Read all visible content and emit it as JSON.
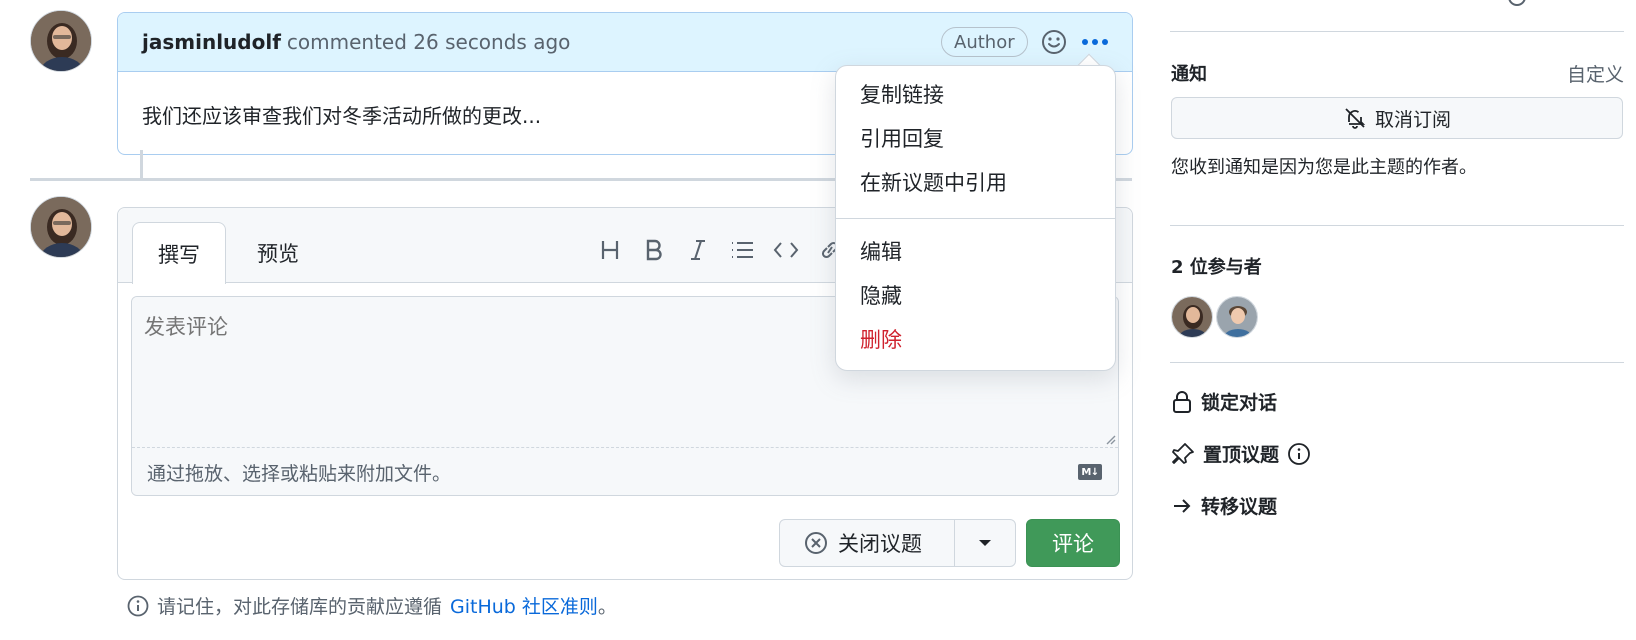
{
  "comment": {
    "author": "jasminludolf",
    "meta": "commented 26 seconds ago",
    "badge": "Author",
    "body": "我们还应该审查我们对冬季活动所做的更改..."
  },
  "menu": {
    "items_top": [
      "复制链接",
      "引用回复",
      "在新议题中引用"
    ],
    "items_bottom": [
      "编辑",
      "隐藏"
    ],
    "danger_item": "删除"
  },
  "editor": {
    "tab_write": "撰写",
    "tab_preview": "预览",
    "toolbar": [
      "heading-icon",
      "bold-icon",
      "italic-icon",
      "list-icon",
      "code-icon",
      "link-icon"
    ],
    "placeholder": "发表评论",
    "attach_hint": "通过拖放、选择或粘贴来附加文件。",
    "md_badge": "M↓",
    "close_issue_label": "关闭议题",
    "comment_label": "评论"
  },
  "guideline": {
    "prefix": "请记住，对此存储库的贡献应遵循",
    "link": "GitHub 社区准则",
    "suffix": "。"
  },
  "sidebar": {
    "notifications_heading": "通知",
    "customize": "自定义",
    "unsubscribe_label": "取消订阅",
    "notification_note": "您收到通知是因为您是此主题的作者。",
    "participants_heading": "2 位参与者",
    "actions": [
      "锁定对话",
      "置顶议题",
      "转移议题"
    ]
  },
  "colors": {
    "accent_blue": "#0969da",
    "header_blue_bg": "#ddf4ff",
    "primary_green": "#1f883d",
    "danger_red": "#cf222e"
  }
}
